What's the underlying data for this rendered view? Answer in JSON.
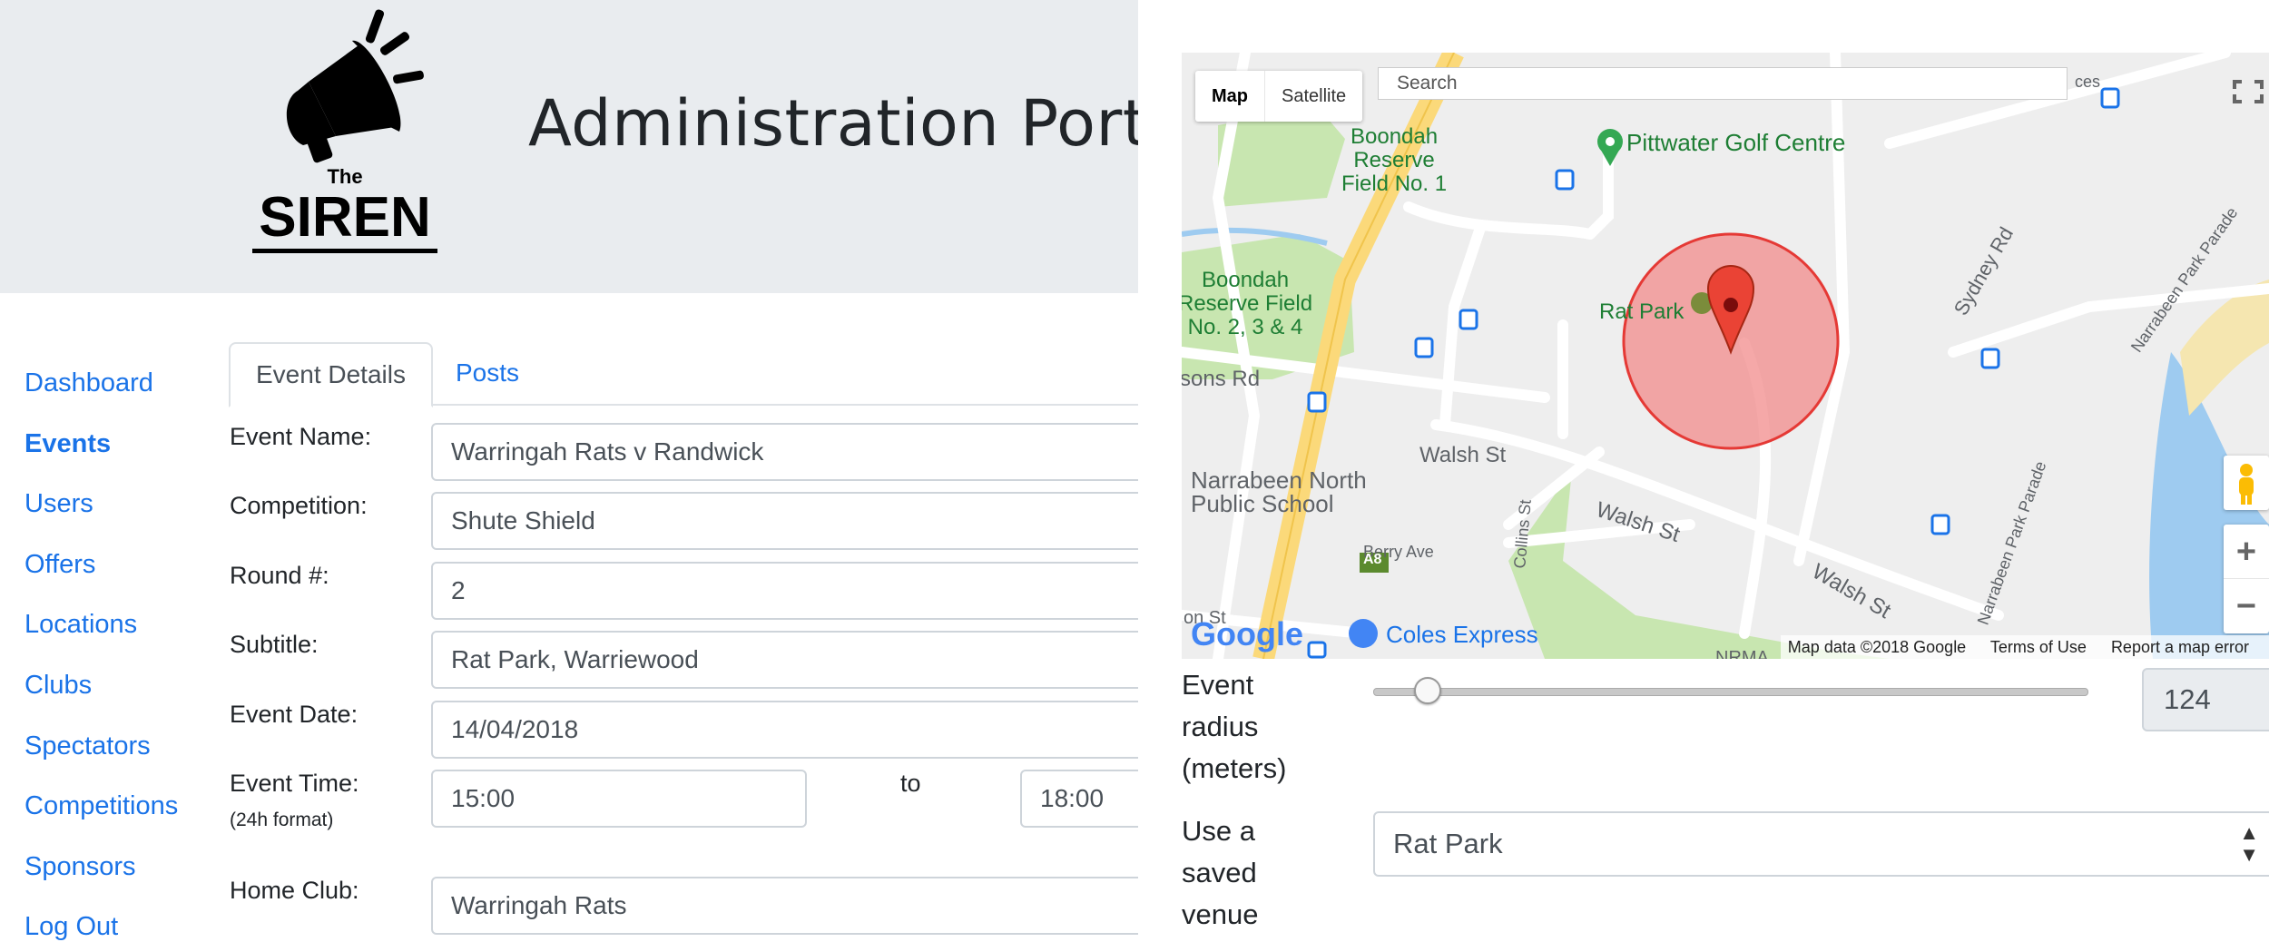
{
  "header": {
    "logo_small": "The",
    "logo_big": "SIREN",
    "title": "Administration Portal"
  },
  "sidebar": {
    "items": [
      {
        "label": "Dashboard"
      },
      {
        "label": "Events"
      },
      {
        "label": "Users"
      },
      {
        "label": "Offers"
      },
      {
        "label": "Locations"
      },
      {
        "label": "Clubs"
      },
      {
        "label": "Spectators"
      },
      {
        "label": "Competitions"
      },
      {
        "label": "Sponsors"
      },
      {
        "label": "Log Out"
      }
    ],
    "active": "Events"
  },
  "tabs": [
    {
      "label": "Event Details",
      "active": true
    },
    {
      "label": "Posts",
      "active": false
    }
  ],
  "form": {
    "event_name": {
      "label": "Event Name:",
      "value": "Warringah Rats v Randwick"
    },
    "competition": {
      "label": "Competition:",
      "value": "Shute Shield"
    },
    "round": {
      "label": "Round #:",
      "value": "2"
    },
    "subtitle": {
      "label": "Subtitle:",
      "value": "Rat Park, Warriewood"
    },
    "event_date": {
      "label": "Event Date:",
      "value": "14/04/2018"
    },
    "event_time": {
      "label": "Event Time:",
      "sublabel": "(24h format)",
      "start": "15:00",
      "to": "to",
      "end": "18:00"
    },
    "home_club": {
      "label": "Home Club:",
      "value": "Warringah Rats"
    }
  },
  "map": {
    "type_buttons": [
      "Map",
      "Satellite"
    ],
    "selected_type": "Map",
    "search_placeholder": "Search",
    "places": {
      "boondah1": [
        "Boondah",
        "Reserve",
        "Field No. 1"
      ],
      "boondah2": [
        "Boondah",
        "Reserve Field",
        "No. 2, 3 & 4"
      ],
      "golf": "Pittwater Golf Centre",
      "ratpark": "Rat Park",
      "school": [
        "Narrabeen North",
        "Public School"
      ],
      "coles": "Coles Express",
      "nrma": "NRMA"
    },
    "streets": {
      "sons_rd": "sons Rd",
      "walsh_st": "Walsh St",
      "walsh_st2": "Walsh St",
      "walsh_st3": "Walsh St",
      "berry": "Berry Ave",
      "collins": "Collins St",
      "sydney_rd": "Sydney Rd",
      "narrabeen_pk": "Narrabeen Park Parade",
      "narrabeen_pk2": "Narrabeen Park Parade",
      "on_st": "on St",
      "ces": "ces",
      "a8": "A8"
    },
    "logo": "Google",
    "footer": {
      "data": "Map data ©2018 Google",
      "terms": "Terms of Use",
      "report": "Report a map error"
    },
    "colors": {
      "circle": "#f28b8b",
      "pin": "#ea4335",
      "park": "#c8e6b0",
      "highway": "#fbd97a"
    }
  },
  "radius": {
    "label": [
      "Event",
      "radius",
      "(meters)"
    ],
    "value": "124",
    "slider_fraction": 0.06
  },
  "venue": {
    "label": [
      "Use a",
      "saved",
      "venue"
    ],
    "selected": "Rat Park"
  }
}
